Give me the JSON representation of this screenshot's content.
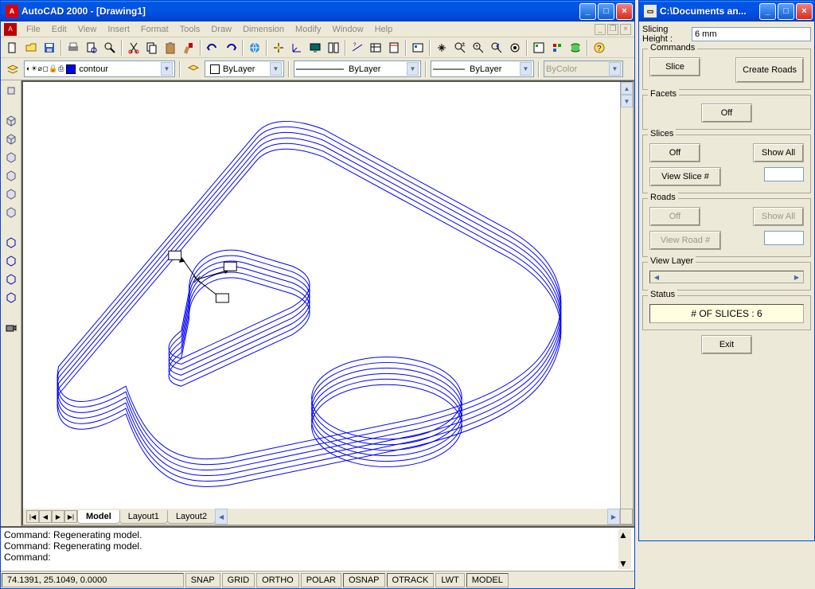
{
  "main_window": {
    "title": "AutoCAD 2000 - [Drawing1]",
    "menus": [
      "File",
      "Edit",
      "View",
      "Insert",
      "Format",
      "Tools",
      "Draw",
      "Dimension",
      "Modify",
      "Window",
      "Help"
    ]
  },
  "property_bar": {
    "layer_status_icons": "◐ ☀ ⌀ ◻ 🔒 ⎙",
    "layer_name": "contour",
    "color_label": "ByLayer",
    "linetype": "ByLayer",
    "lineweight": "ByLayer",
    "bycolor": "ByColor"
  },
  "tabs": {
    "model": "Model",
    "layout1": "Layout1",
    "layout2": "Layout2"
  },
  "command_lines": "Command: Regenerating model.\nCommand: Regenerating model.\nCommand:",
  "status": {
    "coords": "74.1391, 25.1049, 0.0000",
    "toggles": [
      "SNAP",
      "GRID",
      "ORTHO",
      "POLAR",
      "OSNAP",
      "OTRACK",
      "LWT",
      "MODEL"
    ]
  },
  "side_window": {
    "title": "C:\\Documents an...",
    "slicing_height_label": "Slicing Height :",
    "slicing_height_value": "6 mm",
    "commands_legend": "Commands",
    "slice_btn": "Slice",
    "create_roads_btn": "Create Roads",
    "facets_legend": "Facets",
    "facets_off_btn": "Off",
    "slices_legend": "Slices",
    "slices_off_btn": "Off",
    "slices_showall_btn": "Show All",
    "view_slice_btn": "View Slice #",
    "view_slice_value": "",
    "roads_legend": "Roads",
    "roads_off_btn": "Off",
    "roads_showall_btn": "Show All",
    "view_road_btn": "View Road #",
    "view_road_value": "",
    "view_layer_legend": "View Layer",
    "status_legend": "Status",
    "status_text": "# OF SLICES : 6",
    "exit_btn": "Exit"
  }
}
